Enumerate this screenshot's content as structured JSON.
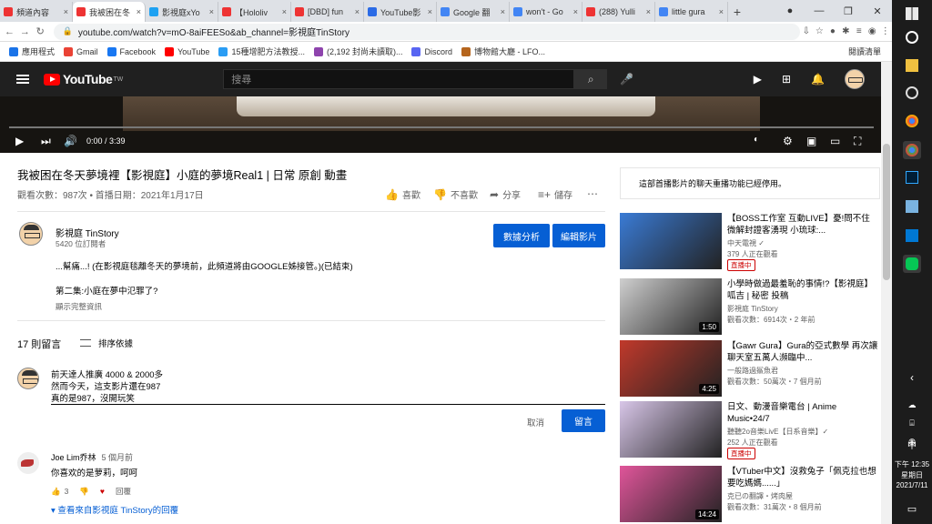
{
  "browser": {
    "tabs": [
      {
        "label": "頻道內容",
        "color": "#e33"
      },
      {
        "label": "我被困在冬",
        "color": "#e33",
        "active": true
      },
      {
        "label": "影視庭xYo",
        "color": "#1da1f2"
      },
      {
        "label": "【Hololiv",
        "color": "#e33"
      },
      {
        "label": "[DBD] fun",
        "color": "#e33"
      },
      {
        "label": "YouTube影",
        "color": "#2b6be6"
      },
      {
        "label": "Google 翻",
        "color": "#4285f4"
      },
      {
        "label": "won't - Go",
        "color": "#4285f4"
      },
      {
        "label": "(288) Yulli",
        "color": "#e33"
      },
      {
        "label": "little gura",
        "color": "#4285f4"
      }
    ],
    "url": "youtube.com/watch?v=mO-8aiFEESo&ab_channel=影視庭TinStory",
    "bookmarks": [
      "應用程式",
      "Gmail",
      "Facebook",
      "YouTube",
      "15種增肥方法教授...",
      "(2,192 封尚未讀取)...",
      "Discord",
      "博物館大廳 - LFO..."
    ],
    "reading_list": "閱讀清單"
  },
  "yt": {
    "logo": "YouTube",
    "tw": "TW",
    "search_placeholder": "搜尋"
  },
  "player": {
    "time": "0:00 / 3:39",
    "progress": 0.0
  },
  "video": {
    "title": "我被困在冬天夢境裡【影視庭】小庭的夢境Real1 | 日常 原創 動畫",
    "meta": "觀看次數：987次 • 首播日期：2021年1月17日",
    "like": "喜歡",
    "dislike": "不喜歡",
    "share": "分享",
    "save": "儲存"
  },
  "channel": {
    "name": "影視庭 TinStory",
    "subs": "5420 位訂閱者",
    "analytics": "數據分析",
    "edit": "編輯影片"
  },
  "description": {
    "line1": "...幫痛...! (在影視庭毯離冬天的夢境前，此頻道將由GOOGLE姊接管。)(已結束)",
    "line2": "第二集:小庭在夢中氾罪了?",
    "more": "顯示完整資訊"
  },
  "comments": {
    "count": "17 則留言",
    "sort": "排序依據",
    "draft": [
      "前天達人推廣 4000 & 2000多",
      "然而今天，這支影片還在987",
      "真的是987，沒開玩笑"
    ],
    "cancel": "取消",
    "submit": "留言",
    "first": {
      "author": "Joe Lim乔林",
      "time": "5 個月前",
      "text": "你喜欢的是萝莉，呵呵",
      "likes": "3",
      "reply": "回覆"
    },
    "replies": "查看來自影視庭 TinStory的回覆"
  },
  "chat_notice": "這部首播影片的聊天重播功能已經停用。",
  "related": [
    {
      "title": "【BOSS工作室 互動LIVE】憂!問不住 微解封證客湧現 小琉球:...",
      "channel": "中天電視 ✓",
      "stats": "379 人正在觀看",
      "live": "直播中",
      "thumb": "#3a7bd5"
    },
    {
      "title": "小學時做過最羞恥的事情!?【影視庭】 呱吉 | 秘密 投稿",
      "channel": "影視庭 TinStory",
      "stats": "觀看次數：6914次・2 年前",
      "duration": "1:50",
      "thumb": "#cfcfcf"
    },
    {
      "title": "【Gawr Gura】Gura的亞式數學 再次讓聊天室五萬人瀕臨中...",
      "channel": "一般路過鯊魚君",
      "stats": "觀看次數：50萬次・7 個月前",
      "duration": "4:25",
      "thumb": "#c0392b"
    },
    {
      "title": "日文、動漫音樂電台 | Anime Music•24/7",
      "channel": "聽聽2o音樂LivE【日系音樂】✓",
      "stats": "252 人正在觀看",
      "live": "直播中",
      "thumb": "#d8c6e8"
    },
    {
      "title": "【VTuber中文】沒救兔子「佩克拉也想要吃媽媽......」",
      "channel": "克已の翻譯・烤肉屋",
      "stats": "觀看次數：31萬次・8 個月前",
      "duration": "14:24",
      "thumb": "#e0559a"
    }
  ],
  "taskbar": {
    "time": "下午 12:35",
    "day": "星期日",
    "date": "2021/7/11",
    "ime": "中"
  }
}
